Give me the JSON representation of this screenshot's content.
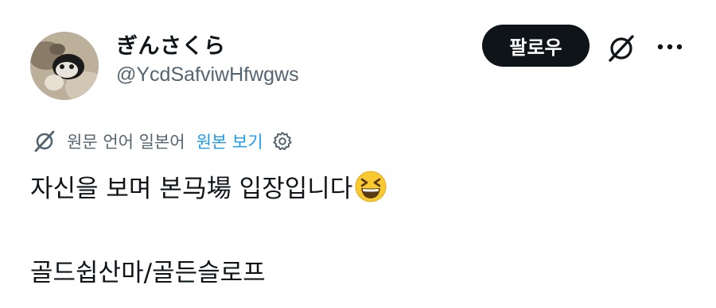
{
  "author": {
    "display_name": "ぎんさくら",
    "handle": "@YcdSafviwHfwgws",
    "avatar_icon": "profile-photo"
  },
  "actions": {
    "follow_label": "팔로우",
    "grok_icon": "grok-icon",
    "more_icon": "more-icon"
  },
  "translation": {
    "note": "원문 언어 일본어",
    "show_original": "원본 보기",
    "translate_icon": "translate-icon",
    "settings_icon": "gear-icon"
  },
  "post": {
    "line1": "자신을 보며 본马場 입장입니다",
    "emoji": "grinning-squinting-face",
    "line2": "골드쉽산마/골든슬로프"
  },
  "colors": {
    "text": "#0f1419",
    "secondary": "#536471",
    "link": "#1d9bf0",
    "button_bg": "#0f1419",
    "button_text": "#ffffff"
  }
}
